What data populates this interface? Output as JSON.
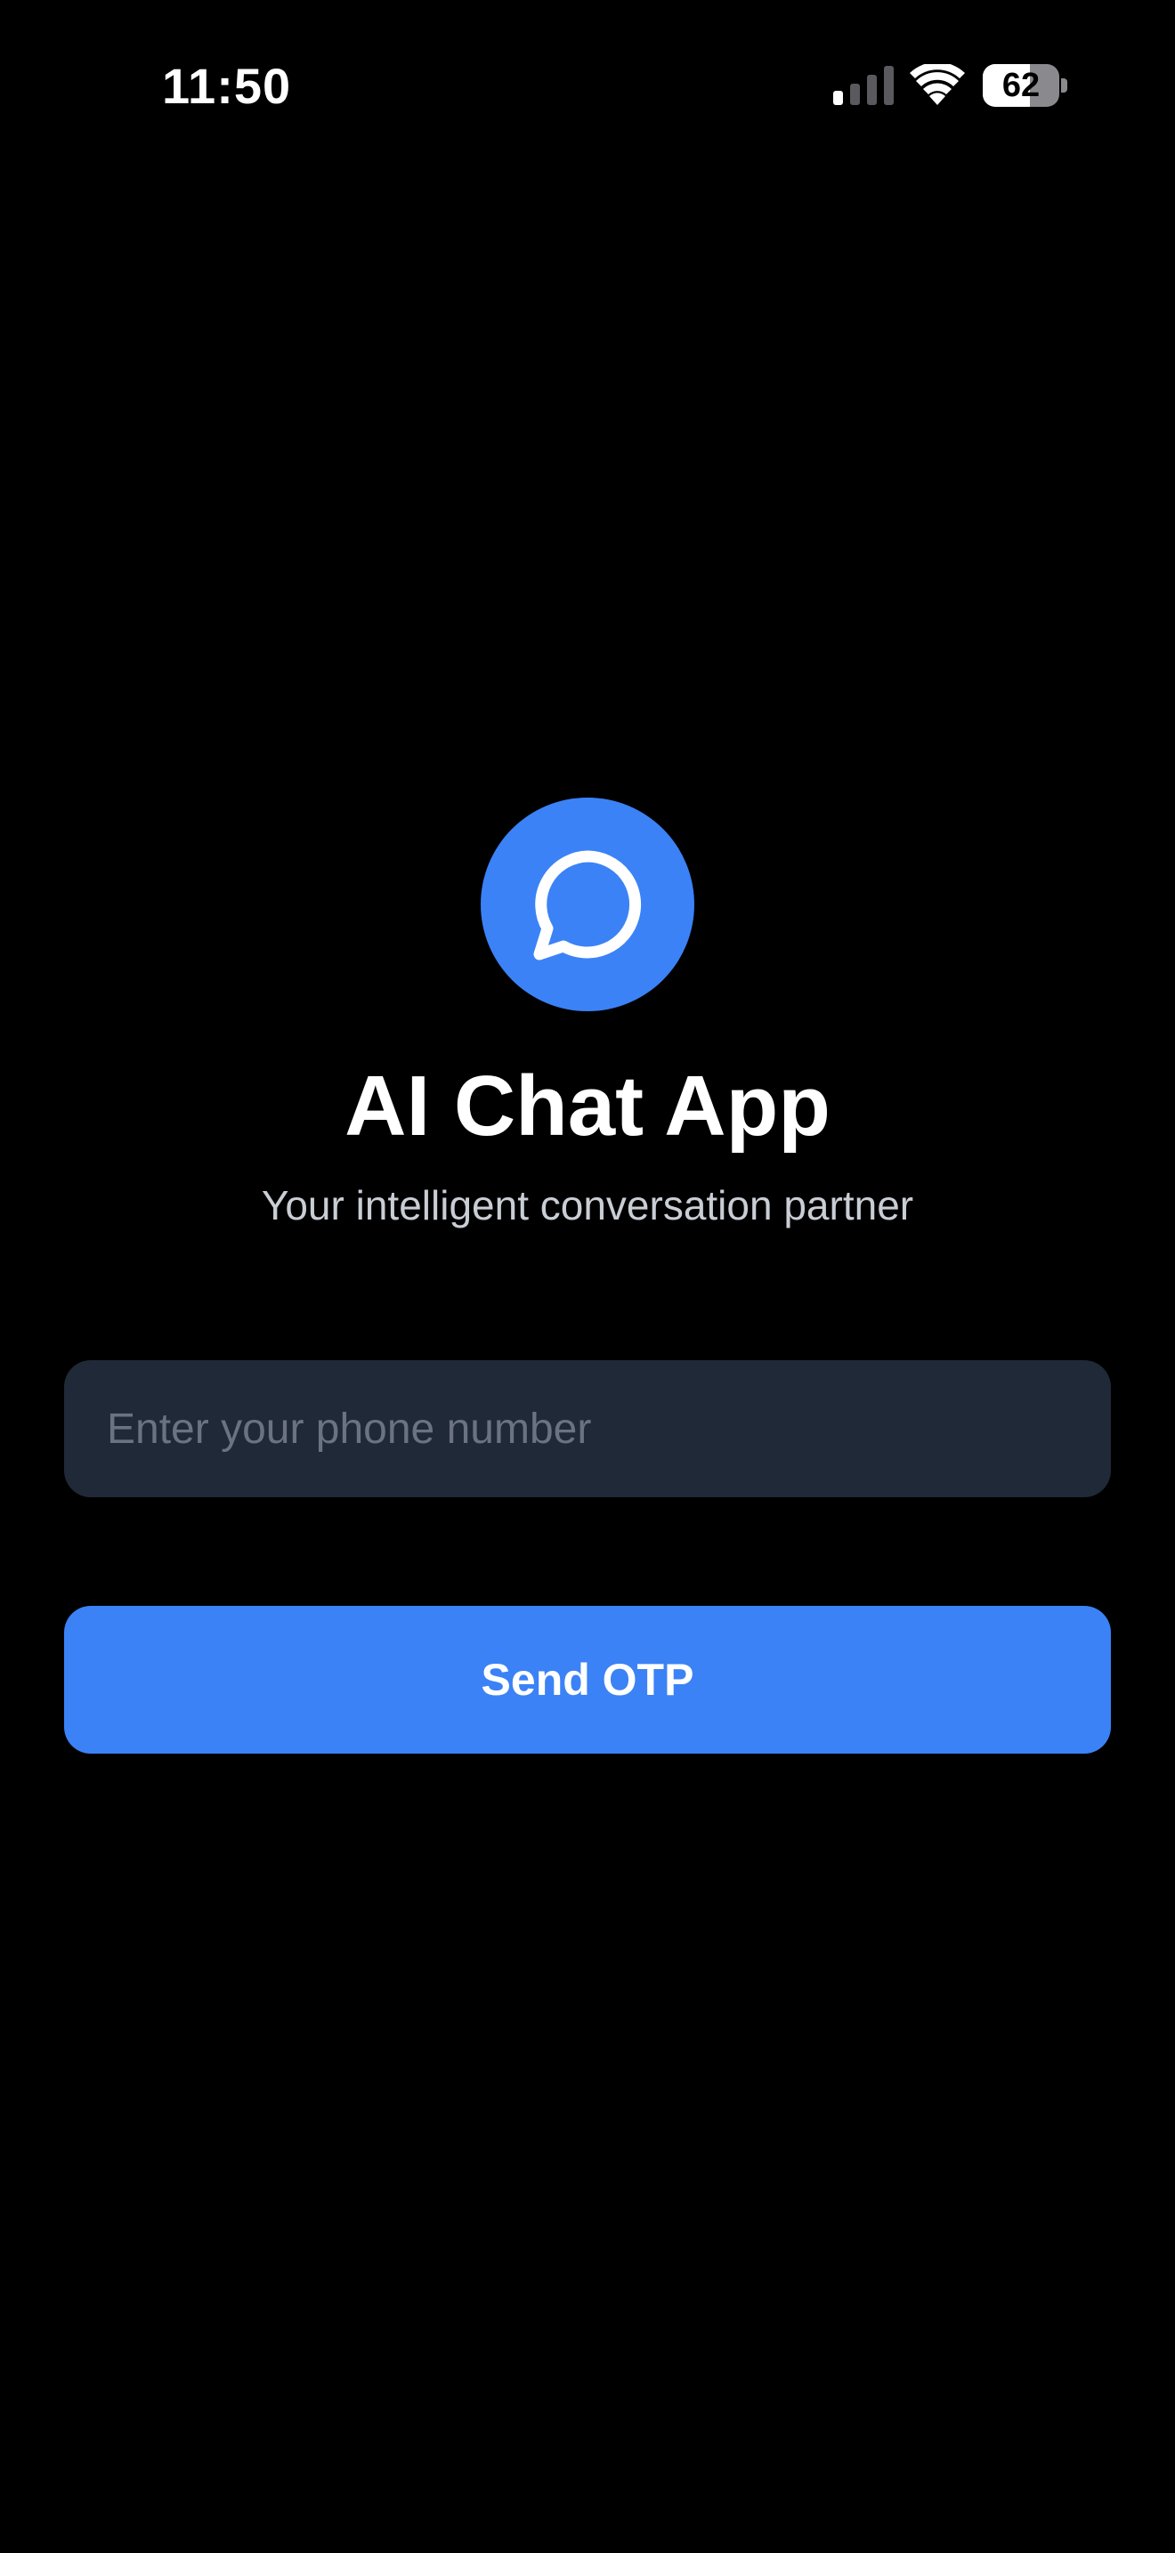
{
  "status_bar": {
    "time": "11:50",
    "battery_level": "62",
    "battery_fraction": 0.62,
    "icons": [
      "cellular-signal-icon",
      "wifi-icon",
      "battery-icon"
    ]
  },
  "app": {
    "logo_icon": "chat-bubble-icon",
    "title": "AI Chat App",
    "subtitle": "Your intelligent conversation partner"
  },
  "form": {
    "phone_placeholder": "Enter your phone number",
    "phone_value": "",
    "send_label": "Send OTP"
  },
  "colors": {
    "background": "#000000",
    "accent": "#3b82f6",
    "input_background": "#1f2937",
    "placeholder": "#6b7280",
    "subtitle": "#c9cdd4"
  }
}
